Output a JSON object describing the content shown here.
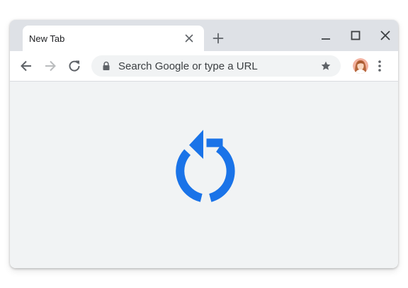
{
  "tab": {
    "title": "New Tab"
  },
  "omnibox": {
    "placeholder": "Search Google or type a URL"
  },
  "icons": {
    "tab_close": "close-icon",
    "new_tab": "plus-icon",
    "minimize": "minimize-icon",
    "maximize": "maximize-icon",
    "close_window": "close-icon",
    "back": "arrow-back-icon",
    "forward": "arrow-forward-icon",
    "reload": "reload-icon",
    "lock": "lock-icon",
    "bookmark": "star-icon",
    "profile": "avatar",
    "menu": "more-vert-icon",
    "hero": "reload-icon"
  },
  "colors": {
    "accent": "#1a73e8",
    "tabstrip": "#dee1e6",
    "content": "#f1f3f4",
    "icon": "#5f6368",
    "icon_disabled": "#babcbe"
  }
}
